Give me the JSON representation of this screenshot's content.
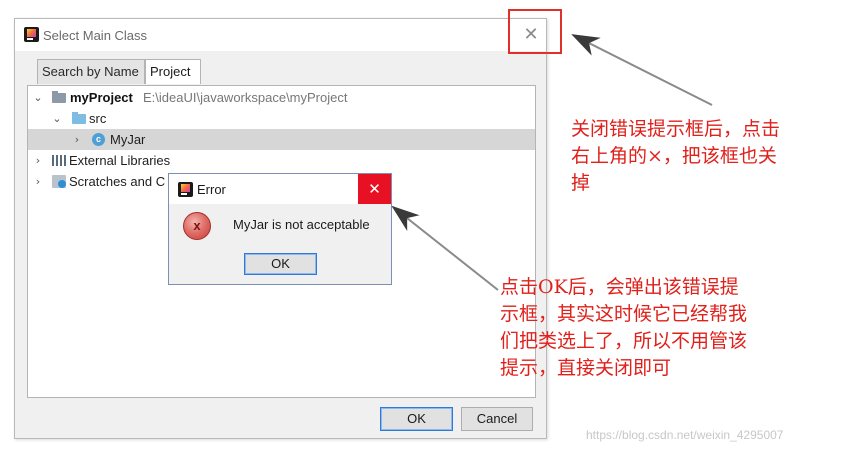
{
  "dialog": {
    "title": "Select Main Class",
    "close_glyph": "✕",
    "tabs": [
      {
        "label": "Search by Name",
        "active": false
      },
      {
        "label": "Project",
        "active": true
      }
    ],
    "tree": [
      {
        "expander": "⌄",
        "name": "myProject",
        "path": "E:\\ideaUI\\javaworkspace\\myProject",
        "icon": "module-folder-icon"
      },
      {
        "expander": "⌄",
        "name": "src",
        "icon": "source-folder-icon"
      },
      {
        "expander": "›",
        "name": "MyJar",
        "icon": "class-icon",
        "icon_letter": "c",
        "selected": true
      },
      {
        "expander": "›",
        "name": "External Libraries",
        "icon": "library-icon"
      },
      {
        "expander": "›",
        "name": "Scratches and C",
        "icon": "scratches-icon"
      }
    ],
    "ok_label": "OK",
    "cancel_label": "Cancel"
  },
  "error_dialog": {
    "title": "Error",
    "close_glyph": "✕",
    "icon_letter": "x",
    "message": "MyJar is not acceptable",
    "ok_label": "OK"
  },
  "annotations": {
    "top_note": [
      "关闭错误提示框后，点击",
      "右上角的×，把该框也关",
      "掉"
    ],
    "bottom_note": [
      "点击OK后，会弹出该错误提",
      "示框，其实这时候它已经帮我",
      "们把类选上了，所以不用管该",
      "提示，直接关闭即可"
    ],
    "color": "#e0201b"
  },
  "watermark": "https://blog.csdn.net/weixin_4295007"
}
